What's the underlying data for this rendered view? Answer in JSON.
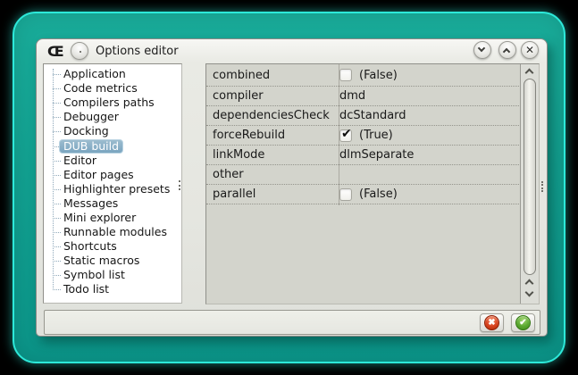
{
  "window": {
    "title": "Options editor",
    "app_icon_glyph": "Œ",
    "close_glyph": "✕"
  },
  "sidebar": {
    "items": [
      "Application",
      "Code metrics",
      "Compilers paths",
      "Debugger",
      "Docking",
      "DUB build",
      "Editor",
      "Editor pages",
      "Highlighter presets",
      "Messages",
      "Mini explorer",
      "Runnable modules",
      "Shortcuts",
      "Static macros",
      "Symbol list",
      "Todo list"
    ],
    "selected": "DUB build"
  },
  "properties": {
    "check_glyph": "✔",
    "rows": [
      {
        "name": "combined",
        "kind": "bool",
        "checked": false,
        "value": "(False)"
      },
      {
        "name": "compiler",
        "kind": "text",
        "value": "dmd"
      },
      {
        "name": "dependenciesCheck",
        "kind": "text",
        "value": "dcStandard"
      },
      {
        "name": "forceRebuild",
        "kind": "bool",
        "checked": true,
        "value": "(True)"
      },
      {
        "name": "linkMode",
        "kind": "text",
        "value": "dlmSeparate"
      },
      {
        "name": "other",
        "kind": "text",
        "value": ""
      },
      {
        "name": "parallel",
        "kind": "bool",
        "checked": false,
        "value": "(False)"
      }
    ]
  },
  "footer": {
    "cancel_glyph": "✖",
    "ok_glyph": "✔"
  },
  "colors": {
    "desktop_teal": "#12a090",
    "desktop_edge": "#2de9d9",
    "selection_blue": "#7aa5c0",
    "grid_bg": "#d3d4cc",
    "cancel_red": "#d8431f",
    "ok_green": "#5aa930"
  }
}
